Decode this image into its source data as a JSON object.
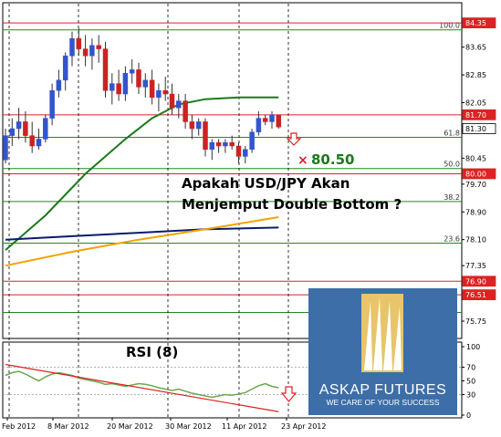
{
  "colors": {
    "bull": "#3355cc",
    "bear": "#cc2222",
    "wick": "#333333",
    "ma_green": "#1a7a1a",
    "ma_navy": "#0a1a6e",
    "ma_orange": "#f2a400",
    "level_red": "#dd2222",
    "level_green": "#228822",
    "rsi_line": "#6aa84f",
    "trend_red": "#dd2222",
    "logo_bg": "#3d6ea8",
    "logo_gold": "#e8c56a"
  },
  "headline": {
    "line1": "Apakah USD/JPY Akan",
    "line2": "Menjemput Double Bottom ?"
  },
  "target_label": "80.50",
  "rsi_title": "RSI (8)",
  "logo": {
    "brand": "ASKAP FUTURES",
    "tagline": "WE CARE OF YOUR SUCCESS"
  },
  "chart_data": [
    {
      "type": "candlestick",
      "title": "",
      "ylim": [
        75.25,
        84.8
      ],
      "y_ticks": [
        "84.35",
        "83.65",
        "82.85",
        "82.05",
        "81.25",
        "80.45",
        "79.70",
        "78.90",
        "78.10",
        "77.35",
        "76.55",
        "75.75"
      ],
      "x_ticks": [
        "Feb 2012",
        "8 Mar 2012",
        "20 Mar 2012",
        "30 Mar 2012",
        "11 Apr 2012",
        "23 Apr 2012"
      ],
      "candles": [
        {
          "o": 80.4,
          "h": 81.3,
          "l": 80.3,
          "c": 81.1
        },
        {
          "o": 81.1,
          "h": 81.6,
          "l": 80.8,
          "c": 81.3
        },
        {
          "o": 81.3,
          "h": 81.9,
          "l": 81.0,
          "c": 81.5
        },
        {
          "o": 81.5,
          "h": 81.8,
          "l": 80.9,
          "c": 81.1
        },
        {
          "o": 81.1,
          "h": 81.5,
          "l": 80.6,
          "c": 80.8
        },
        {
          "o": 80.8,
          "h": 81.3,
          "l": 80.7,
          "c": 81.0
        },
        {
          "o": 81.0,
          "h": 81.7,
          "l": 80.9,
          "c": 81.6
        },
        {
          "o": 81.6,
          "h": 82.6,
          "l": 81.4,
          "c": 82.4
        },
        {
          "o": 82.4,
          "h": 83.0,
          "l": 82.2,
          "c": 82.7
        },
        {
          "o": 82.7,
          "h": 83.5,
          "l": 82.4,
          "c": 83.4
        },
        {
          "o": 83.4,
          "h": 84.1,
          "l": 83.1,
          "c": 83.9
        },
        {
          "o": 83.9,
          "h": 84.2,
          "l": 83.4,
          "c": 83.6
        },
        {
          "o": 83.6,
          "h": 84.0,
          "l": 83.1,
          "c": 83.4
        },
        {
          "o": 83.4,
          "h": 83.9,
          "l": 83.0,
          "c": 83.7
        },
        {
          "o": 83.7,
          "h": 84.0,
          "l": 83.2,
          "c": 83.6
        },
        {
          "o": 83.6,
          "h": 83.8,
          "l": 82.2,
          "c": 82.4
        },
        {
          "o": 82.4,
          "h": 82.9,
          "l": 82.0,
          "c": 82.6
        },
        {
          "o": 82.6,
          "h": 83.0,
          "l": 82.1,
          "c": 82.3
        },
        {
          "o": 82.3,
          "h": 83.1,
          "l": 82.1,
          "c": 82.9
        },
        {
          "o": 82.9,
          "h": 83.3,
          "l": 82.6,
          "c": 83.0
        },
        {
          "o": 83.0,
          "h": 83.2,
          "l": 82.3,
          "c": 82.5
        },
        {
          "o": 82.5,
          "h": 82.9,
          "l": 82.2,
          "c": 82.7
        },
        {
          "o": 82.7,
          "h": 83.0,
          "l": 82.0,
          "c": 82.2
        },
        {
          "o": 82.2,
          "h": 82.6,
          "l": 81.8,
          "c": 82.4
        },
        {
          "o": 82.4,
          "h": 82.8,
          "l": 82.1,
          "c": 82.3
        },
        {
          "o": 82.3,
          "h": 82.6,
          "l": 81.7,
          "c": 81.9
        },
        {
          "o": 81.9,
          "h": 82.3,
          "l": 81.6,
          "c": 82.1
        },
        {
          "o": 82.1,
          "h": 82.3,
          "l": 81.3,
          "c": 81.5
        },
        {
          "o": 81.5,
          "h": 81.7,
          "l": 81.0,
          "c": 81.3
        },
        {
          "o": 81.3,
          "h": 81.6,
          "l": 81.1,
          "c": 81.5
        },
        {
          "o": 81.5,
          "h": 81.6,
          "l": 80.5,
          "c": 80.7
        },
        {
          "o": 80.7,
          "h": 81.0,
          "l": 80.4,
          "c": 80.9
        },
        {
          "o": 80.9,
          "h": 81.0,
          "l": 80.6,
          "c": 80.8
        },
        {
          "o": 80.8,
          "h": 81.0,
          "l": 80.6,
          "c": 80.9
        },
        {
          "o": 80.9,
          "h": 81.1,
          "l": 80.7,
          "c": 80.8
        },
        {
          "o": 80.8,
          "h": 80.9,
          "l": 80.3,
          "c": 80.5
        },
        {
          "o": 80.5,
          "h": 80.8,
          "l": 80.3,
          "c": 80.7
        },
        {
          "o": 80.7,
          "h": 81.3,
          "l": 80.6,
          "c": 81.2
        },
        {
          "o": 81.2,
          "h": 81.8,
          "l": 81.1,
          "c": 81.6
        },
        {
          "o": 81.6,
          "h": 81.7,
          "l": 81.4,
          "c": 81.5
        },
        {
          "o": 81.5,
          "h": 81.8,
          "l": 81.3,
          "c": 81.7
        },
        {
          "o": 81.7,
          "h": 81.7,
          "l": 81.3,
          "c": 81.35
        }
      ],
      "moving_averages": [
        {
          "color": "ma_green",
          "points": [
            [
              0,
              77.8
            ],
            [
              6,
              78.8
            ],
            [
              12,
              80.0
            ],
            [
              18,
              81.0
            ],
            [
              22,
              81.6
            ],
            [
              26,
              82.0
            ],
            [
              30,
              82.15
            ],
            [
              35,
              82.2
            ],
            [
              41,
              82.2
            ]
          ]
        },
        {
          "color": "ma_navy",
          "points": [
            [
              0,
              78.1
            ],
            [
              10,
              78.2
            ],
            [
              20,
              78.3
            ],
            [
              30,
              78.4
            ],
            [
              41,
              78.45
            ]
          ]
        },
        {
          "color": "ma_orange",
          "points": [
            [
              0,
              77.35
            ],
            [
              10,
              77.75
            ],
            [
              20,
              78.1
            ],
            [
              30,
              78.4
            ],
            [
              41,
              78.75
            ]
          ]
        }
      ],
      "levels": [
        {
          "label": "100.0",
          "value": 84.15,
          "color": "level_green",
          "box": false
        },
        {
          "label": "",
          "value": 84.35,
          "color": "level_red",
          "box": true,
          "box_text": "84.35"
        },
        {
          "label": "",
          "value": 81.7,
          "color": "level_red",
          "box": true,
          "box_text": "81.70"
        },
        {
          "label": "61.8",
          "value": 81.05,
          "color": "level_green",
          "box": false
        },
        {
          "label": "",
          "value": 81.3,
          "color": "none",
          "box": true,
          "box_text": "81.30",
          "box_style": "current"
        },
        {
          "label": "50.0",
          "value": 80.15,
          "color": "level_green",
          "box": false
        },
        {
          "label": "",
          "value": 80.0,
          "color": "level_red",
          "box": true,
          "box_text": "80.00"
        },
        {
          "label": "38.2",
          "value": 79.2,
          "color": "level_green",
          "box": false
        },
        {
          "label": "23.6",
          "value": 78.0,
          "color": "level_green",
          "box": false
        },
        {
          "label": "",
          "value": 76.9,
          "color": "level_red",
          "box": true,
          "box_text": "76.90"
        },
        {
          "label": "",
          "value": 76.51,
          "color": "level_red",
          "box": true,
          "box_text": "76.51"
        },
        {
          "label": "",
          "value": 76.0,
          "color": "level_green",
          "box": false
        }
      ]
    },
    {
      "type": "line",
      "title": "RSI (8)",
      "ylim": [
        0,
        100
      ],
      "y_ticks": [
        "100",
        "70",
        "50",
        "30",
        "0"
      ],
      "values": [
        58,
        62,
        64,
        60,
        55,
        50,
        56,
        60,
        62,
        60,
        58,
        54,
        52,
        50,
        48,
        45,
        46,
        44,
        42,
        44,
        46,
        45,
        43,
        40,
        38,
        36,
        38,
        35,
        32,
        30,
        28,
        26,
        28,
        30,
        29,
        31,
        33,
        38,
        43,
        46,
        42,
        40
      ],
      "trendline": [
        [
          0,
          74
        ],
        [
          41,
          5
        ]
      ]
    }
  ]
}
